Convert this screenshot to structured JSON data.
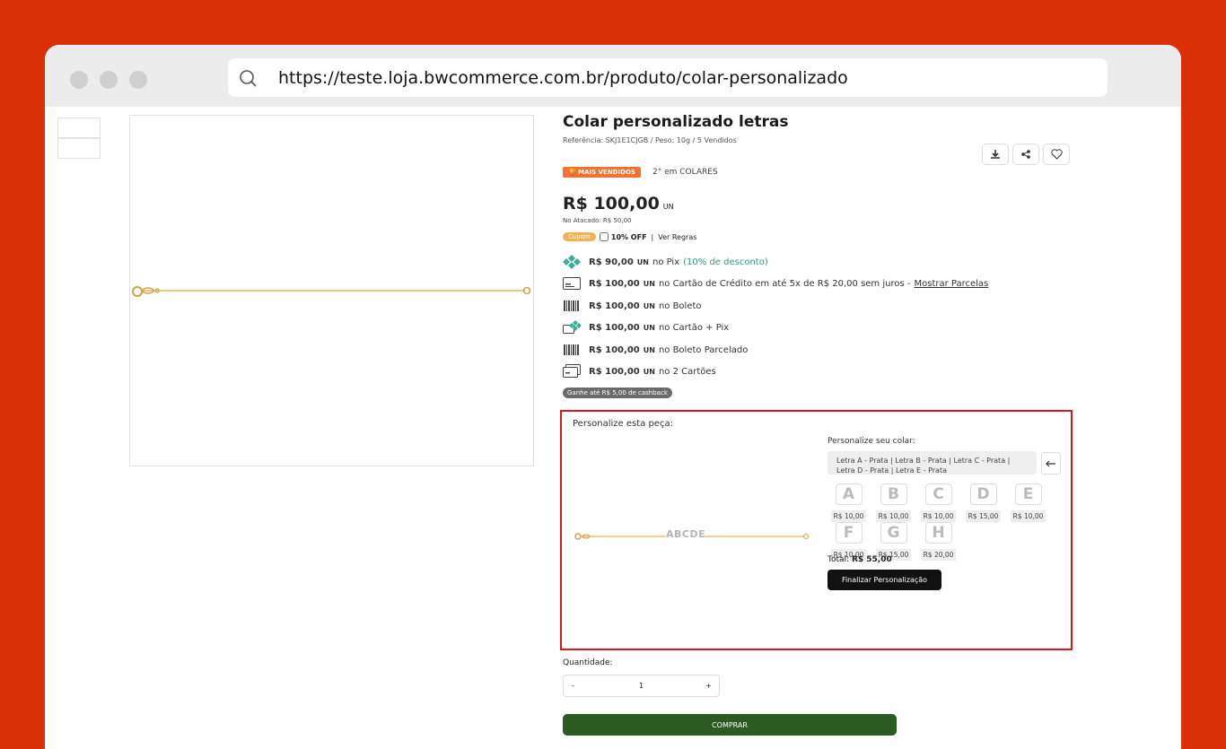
{
  "browser": {
    "url": "https://teste.loja.bwcommerce.com.br/produto/colar-personalizado"
  },
  "product": {
    "title": "Colar personalizado letras",
    "reference_line": "Referência: SKJ1E1CJGB  /  Peso: 10g  /  5 Vendidos",
    "badge": "MAIS VENDIDOS",
    "rank": "2° em COLARES",
    "price": "R$ 100,00",
    "price_unit": "UN",
    "wholesale": "No Atacado: R$ 50,00",
    "coupon_badge": "Cupom",
    "coupon_text": "10% OFF",
    "coupon_sep": "|",
    "coupon_rules": "Ver Regras",
    "cashback": "Ganhe até R$ 5,00 de cashback"
  },
  "payments": [
    {
      "icon": "pix-icon",
      "price": "R$ 90,00",
      "unit": "UN",
      "text": "no Pix",
      "extra": "(10% de desconto)"
    },
    {
      "icon": "credit-card-icon",
      "price": "R$ 100,00",
      "unit": "UN",
      "text": "no Cartão de Crédito em até 5x de R$ 20,00 sem juros -",
      "link": "Mostrar Parcelas"
    },
    {
      "icon": "boleto-icon",
      "price": "R$ 100,00",
      "unit": "UN",
      "text": "no Boleto"
    },
    {
      "icon": "card-pix-icon",
      "price": "R$ 100,00",
      "unit": "UN",
      "text": "no Cartão + Pix"
    },
    {
      "icon": "boleto-icon",
      "price": "R$ 100,00",
      "unit": "UN",
      "text": "no Boleto Parcelado"
    },
    {
      "icon": "two-cards-icon",
      "price": "R$ 100,00",
      "unit": "UN",
      "text": "no 2 Cartões"
    }
  ],
  "customize": {
    "title": "Personalize esta peça:",
    "subtitle": "Personalize seu colar:",
    "select_value": "Letra A - Prata | Letra B - Prata | Letra C - Prata | Letra D - Prata | Letra E - Prata",
    "preview_text": "ABCDE",
    "letters": [
      {
        "letter": "A",
        "price": "R$ 10,00"
      },
      {
        "letter": "B",
        "price": "R$ 10,00"
      },
      {
        "letter": "C",
        "price": "R$ 10,00"
      },
      {
        "letter": "D",
        "price": "R$ 15,00"
      },
      {
        "letter": "E",
        "price": "R$ 10,00"
      },
      {
        "letter": "F",
        "price": "R$ 10,00"
      },
      {
        "letter": "G",
        "price": "R$ 15,00"
      },
      {
        "letter": "H",
        "price": "R$ 20,00"
      }
    ],
    "total_label": "Total:",
    "total_value": "R$ 55,00",
    "finalize_label": "Finalizar Personalização"
  },
  "quantity": {
    "label": "Quantidade:",
    "minus": "-",
    "value": "1",
    "plus": "+"
  },
  "buy_label": "COMPRAR"
}
